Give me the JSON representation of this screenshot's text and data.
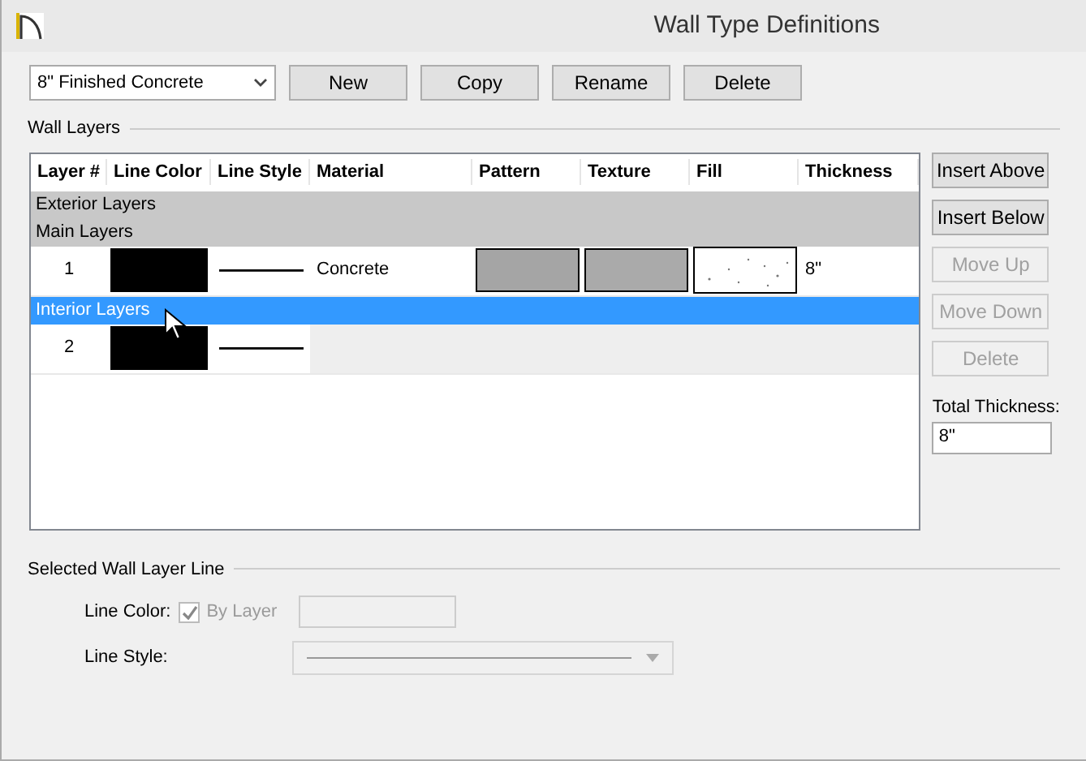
{
  "window": {
    "title": "Wall Type Definitions"
  },
  "wall_type": {
    "value": "8\" Finished Concrete"
  },
  "type_buttons": [
    "New",
    "Copy",
    "Rename",
    "Delete"
  ],
  "wall_layers": {
    "title": "Wall Layers",
    "columns": [
      "Layer #",
      "Line Color",
      "Line Style",
      "Material",
      "Pattern",
      "Texture",
      "Fill",
      "Thickness"
    ],
    "rows": [
      {
        "kind": "group",
        "label": "Exterior Layers",
        "selected": false
      },
      {
        "kind": "group",
        "label": "Main Layers",
        "selected": false
      },
      {
        "kind": "layer",
        "number": "1",
        "material": "Concrete",
        "thickness": "8\"",
        "has_material": true,
        "selected": false
      },
      {
        "kind": "group",
        "label": "Interior Layers",
        "selected": true
      },
      {
        "kind": "layer",
        "number": "2",
        "has_material": false,
        "selected": false
      }
    ]
  },
  "layer_buttons": [
    {
      "label": "Insert Above",
      "disabled": false
    },
    {
      "label": "Insert Below",
      "disabled": false
    },
    {
      "label": "Move Up",
      "disabled": true
    },
    {
      "label": "Move Down",
      "disabled": true
    },
    {
      "label": "Delete",
      "disabled": true
    }
  ],
  "total_thickness": {
    "label": "Total Thickness:",
    "value": "8\""
  },
  "selected_line": {
    "title": "Selected Wall Layer Line",
    "line_color_label": "Line Color:",
    "by_layer": {
      "label": "By Layer",
      "checked": true,
      "disabled": true
    },
    "line_style_label": "Line Style:"
  }
}
